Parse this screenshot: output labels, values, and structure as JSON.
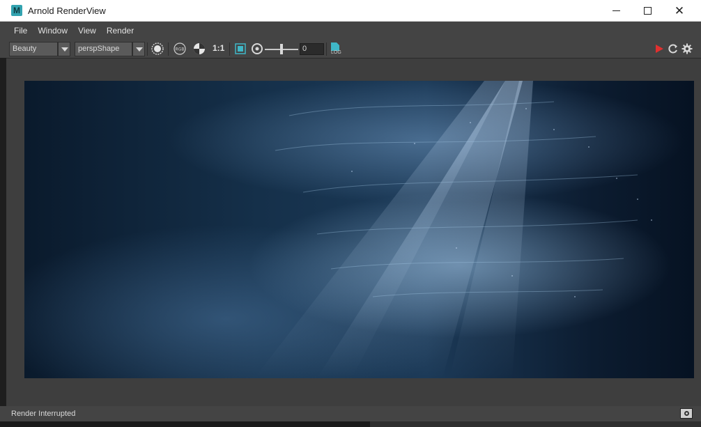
{
  "window": {
    "title": "Arnold RenderView",
    "app_icon_letter": "M"
  },
  "menu": [
    {
      "label": "File"
    },
    {
      "label": "Window"
    },
    {
      "label": "View"
    },
    {
      "label": "Render"
    }
  ],
  "toolbar": {
    "aov_value": "Beauty",
    "camera_value": "perspShape",
    "zoom_label": "1:1",
    "exposure_value": "0",
    "log_label": "LOG"
  },
  "status": {
    "text": "Render Interrupted"
  },
  "colors": {
    "accent": "#33a3b0",
    "render_button": "#e0302f",
    "panel": "#444444",
    "viewport": "#3e3e3e"
  },
  "icons": [
    "maya-app-icon",
    "minimize-icon",
    "maximize-icon",
    "close-icon",
    "dropdown-arrow-icon",
    "sphere-icon",
    "rgb-channel-icon",
    "checker-icon",
    "crop-region-icon",
    "exposure-icon",
    "log-icon",
    "play-render-icon",
    "refresh-icon",
    "gear-icon",
    "snapshot-icon"
  ]
}
